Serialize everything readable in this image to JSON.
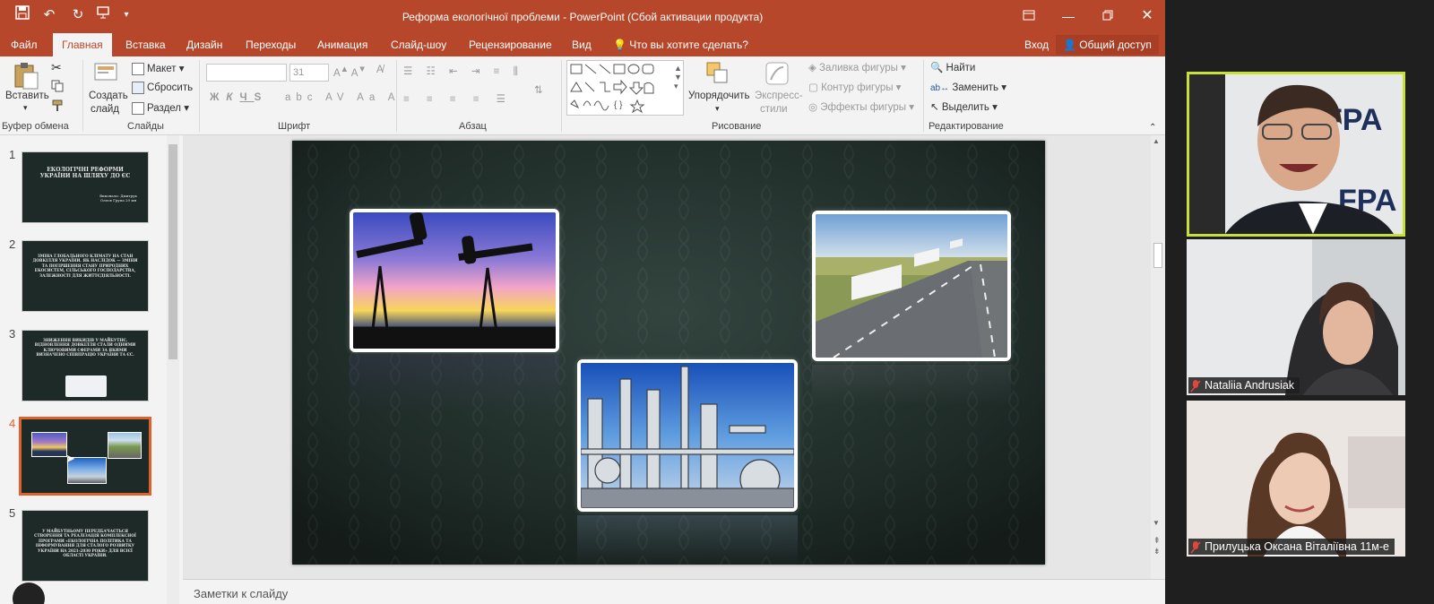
{
  "titlebar": {
    "title": "Реформа екологічної проблеми - PowerPoint (Сбой активации продукта)"
  },
  "tabs": [
    {
      "label": "Файл"
    },
    {
      "label": "Главная"
    },
    {
      "label": "Вставка"
    },
    {
      "label": "Дизайн"
    },
    {
      "label": "Переходы"
    },
    {
      "label": "Анимация"
    },
    {
      "label": "Слайд-шоу"
    },
    {
      "label": "Рецензирование"
    },
    {
      "label": "Вид"
    },
    {
      "label": "Что вы хотите сделать?"
    }
  ],
  "account": {
    "signin": "Вход",
    "share": "Общий доступ"
  },
  "ribbon": {
    "paste": "Вставить",
    "new_slide_1": "Создать",
    "new_slide_2": "слайд",
    "layout": "Макет",
    "reset": "Сбросить",
    "section": "Раздел",
    "font_size": "31",
    "arrange": "Упорядочить",
    "quick_styles_1": "Экспресс-",
    "quick_styles_2": "стили",
    "shape_fill": "Заливка фигуры",
    "shape_outline": "Контур фигуры",
    "shape_effects": "Эффекты фигуры",
    "find": "Найти",
    "replace": "Заменить",
    "select": "Выделить",
    "groups": {
      "clipboard": "Буфер обмена",
      "slides": "Слайды",
      "font": "Шрифт",
      "paragraph": "Абзац",
      "drawing": "Рисование",
      "editing": "Редактирование"
    }
  },
  "thumbnails": [
    {
      "num": "1",
      "title": "ЕКОЛОГІЧНІ РЕФОРМИ УКРАЇНИ НА ШЛЯХУ ДО ЄС"
    },
    {
      "num": "2",
      "title": "ЗМІНА ГЛОБАЛЬНОГО КЛІМАТУ НА СТАН ДОВКІЛЛЯ УКРАЇНИ. ЯК НАСЛІДОК — ЗМІНИ ТА ПОГІРШЕННЯ СТАНУ ПРИРОДНИХ ЕКОСИСТЕМ, СІЛЬСЬКОГО ГОСПОДАРСТВА, ЗАЛЕЖНОСТІ ДЛЯ ЖИТТЄДІЯЛЬНОСТІ."
    },
    {
      "num": "3",
      "title": "ЗНИЖЕННЯ ВИКИДІВ У МАЙБУТНЄ. ВІДНОВЛЕННЯ ДОВКІЛЛЯ СТАЛИ ОДНИМИ КЛЮЧОВИМИ СФЕРАМИ ЗА ЯКИМИ ВИЗНАЧЕНО СПІВПРАЦЮ УКРАЇНИ ТА ЄС."
    },
    {
      "num": "4",
      "title": ""
    },
    {
      "num": "5",
      "title": "У МАЙБУТНЬОМУ ПЕРЕДБАЧАЄТЬСЯ СТВОРЕННЯ ТА РЕАЛІЗАЦІЯ КОМПЛЕКСНОЇ ПРОГРАМИ «ЕКОЛОГІЧНА ПОЛІТИКА ТА ІНФОРМУВАННЯ ДЛЯ СТАЛОГО РОЗВИТКУ УКРАЇНИ НА 2021-2030 РОКИ» ДЛЯ ВСІЄЇ ОБЛАСТІ УКРАЇНИ."
    }
  ],
  "thumb1_sub": "Виконала: Дмитрук Олеся Група 29 мн",
  "notes_label": "Заметки к слайду",
  "participants": [
    {
      "name": "",
      "role": "active-speaker",
      "backdrop_text": "FPA"
    },
    {
      "name": "Nataliia Andrusiak"
    },
    {
      "name": "Прилуцька Оксана Віталіївна 11м-е"
    }
  ],
  "colors": {
    "accent": "#b7472a",
    "selected_thumb": "#e0612b",
    "active_speaker": "#c8e03a"
  },
  "icons": [
    "save-icon",
    "undo-icon",
    "redo-icon",
    "present-icon",
    "customize-icon",
    "ribbon-options-icon",
    "minimize-icon",
    "restore-icon",
    "close-icon",
    "lightbulb-icon",
    "person-icon",
    "paste-icon",
    "cut-icon",
    "copy-icon",
    "format-painter-icon",
    "new-slide-icon",
    "layout-icon",
    "reset-icon",
    "section-icon",
    "arrange-icon",
    "quick-styles-icon",
    "find-icon",
    "replace-icon",
    "select-icon",
    "mic-muted-icon"
  ]
}
